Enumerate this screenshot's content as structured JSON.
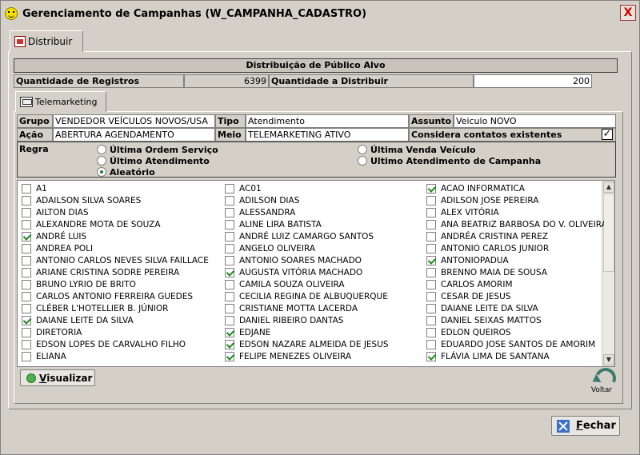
{
  "window": {
    "title": "Gerenciamento de Campanhas (W_CAMPANHA_CADASTRO)"
  },
  "tab_main": {
    "label": "Distribuir"
  },
  "section": {
    "title": "Distribuição de Público Alvo"
  },
  "quantities": {
    "registros_label": "Quantidade de Registros",
    "registros_value": "6399",
    "distribuir_label": "Quantidade a Distribuir",
    "distribuir_value": "200"
  },
  "tab_tele": {
    "label": "Telemarketing"
  },
  "fields": {
    "grupo_label": "Grupo",
    "grupo_value": "VENDEDOR VEÍCULOS NOVOS/USA",
    "tipo_label": "Tipo",
    "tipo_value": "Atendimento",
    "assunto_label": "Assunto",
    "assunto_value": "Veiculo NOVO",
    "acao_label": "Ação",
    "acao_value": "ABERTURA AGENDAMENTO",
    "meio_label": "Meio",
    "meio_value": "TELEMARKETING ATIVO",
    "considera_label": "Considera contatos existentes",
    "considera_checked": true
  },
  "regra": {
    "label": "Regra",
    "options": [
      {
        "label": "Última Ordem Serviço",
        "selected": false
      },
      {
        "label": "Última Venda Veículo",
        "selected": false
      },
      {
        "label": "Último Atendimento",
        "selected": false
      },
      {
        "label": "Ultimo Atendimento de Campanha",
        "selected": false
      },
      {
        "label": "Aleatório",
        "selected": true
      }
    ]
  },
  "list": {
    "columns": [
      [
        {
          "name": "A1",
          "checked": false
        },
        {
          "name": "ADAILSON SILVA SOARES",
          "checked": false
        },
        {
          "name": "AILTON DIAS",
          "checked": false
        },
        {
          "name": "ALEXANDRE MOTA DE SOUZA",
          "checked": false
        },
        {
          "name": "ANDRÉ LUIS",
          "checked": true
        },
        {
          "name": "ANDREA POLI",
          "checked": false
        },
        {
          "name": "ANTONIO CARLOS NEVES SILVA FAILLACE",
          "checked": false
        },
        {
          "name": "ARIANE CRISTINA SODRE PEREIRA",
          "checked": false
        },
        {
          "name": "BRUNO LYRIO DE BRITO",
          "checked": false
        },
        {
          "name": "CARLOS ANTONIO FERREIRA GUEDES",
          "checked": false
        },
        {
          "name": "CLÉBER L'HOTELLIER B. JÚNIOR",
          "checked": false
        },
        {
          "name": "DAIANE LEITE DA SILVA",
          "checked": true
        },
        {
          "name": "DIRETORIA",
          "checked": false
        },
        {
          "name": "EDSON LOPES DE CARVALHO FILHO",
          "checked": false
        },
        {
          "name": "ELIANA",
          "checked": false
        }
      ],
      [
        {
          "name": "AC01",
          "checked": false
        },
        {
          "name": "ADILSON DIAS",
          "checked": false
        },
        {
          "name": "ALESSANDRA",
          "checked": false
        },
        {
          "name": "ALINE LIRA BATISTA",
          "checked": false
        },
        {
          "name": "ANDRÉ LUIZ CAMARGO SANTOS",
          "checked": false
        },
        {
          "name": "ANGELO OLIVEIRA",
          "checked": false
        },
        {
          "name": "ANTONIO SOARES MACHADO",
          "checked": false
        },
        {
          "name": "AUGUSTA VITÓRIA MACHADO",
          "checked": true
        },
        {
          "name": "CAMILA SOUZA OLIVEIRA",
          "checked": false
        },
        {
          "name": "CECILIA REGINA DE ALBUQUERQUE",
          "checked": false
        },
        {
          "name": "CRISTIANE MOTTA LACERDA",
          "checked": false
        },
        {
          "name": "DANIEL RIBEIRO DANTAS",
          "checked": false
        },
        {
          "name": "EDJANE",
          "checked": true
        },
        {
          "name": "EDSON NAZARE ALMEIDA DE JESUS",
          "checked": true
        },
        {
          "name": "FELIPE MENEZES OLIVEIRA",
          "checked": true
        }
      ],
      [
        {
          "name": "ACAO INFORMATICA",
          "checked": true
        },
        {
          "name": "ADILSON JOSE PEREIRA",
          "checked": false
        },
        {
          "name": "ALEX VITÓRIA",
          "checked": false
        },
        {
          "name": "ANA BEATRIZ BARBOSA DO V. OLIVEIRA",
          "checked": false
        },
        {
          "name": "ANDRÉA CRISTINA PEREZ",
          "checked": false
        },
        {
          "name": "ANTONIO CARLOS JUNIOR",
          "checked": false
        },
        {
          "name": "ANTONIOPADUA",
          "checked": true
        },
        {
          "name": "BRENNO MAIA DE SOUSA",
          "checked": false
        },
        {
          "name": "CARLOS AMORIM",
          "checked": false
        },
        {
          "name": "CESAR DE JESUS",
          "checked": false
        },
        {
          "name": "DAIANE LEITE DA SILVA",
          "checked": false
        },
        {
          "name": "DANIEL SEIXAS MATTOS",
          "checked": false
        },
        {
          "name": "EDLON QUEIROS",
          "checked": false
        },
        {
          "name": "EDUARDO JOSE SANTOS DE AMORIM",
          "checked": false
        },
        {
          "name": "FLÁVIA LIMA DE SANTANA",
          "checked": true
        }
      ]
    ]
  },
  "buttons": {
    "visualizar_first": "V",
    "visualizar_rest": "isualizar",
    "voltar": "Voltar",
    "fechar_first": "F",
    "fechar_rest": "echar",
    "close_glyph": "X"
  },
  "icons": {
    "title": "smiley-icon",
    "tab_main": "distribute-icon",
    "tab_tele": "telephone-icon",
    "visualizar": "green-dot-icon",
    "voltar": "back-arrow-icon",
    "fechar": "close-x-icon"
  }
}
